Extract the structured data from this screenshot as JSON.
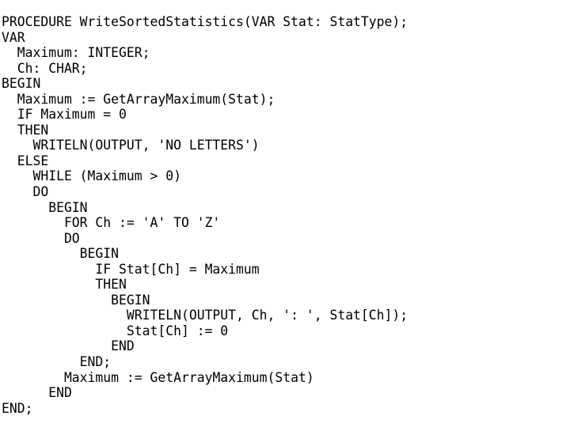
{
  "document": {
    "kind": "source-code-listing",
    "language": "Pascal",
    "procedure_name": "WriteSortedStatistics",
    "background_color": "#ffffff",
    "text_color": "#000000",
    "lines": [
      "PROCEDURE WriteSortedStatistics(VAR Stat: StatType);",
      "VAR",
      "  Maximum: INTEGER;",
      "  Ch: CHAR;",
      "BEGIN",
      "  Maximum := GetArrayMaximum(Stat);",
      "  IF Maximum = 0",
      "  THEN",
      "    WRITELN(OUTPUT, 'NO LETTERS')",
      "  ELSE",
      "    WHILE (Maximum > 0)",
      "    DO",
      "      BEGIN",
      "        FOR Ch := 'A' TO 'Z'",
      "        DO",
      "          BEGIN",
      "            IF Stat[Ch] = Maximum",
      "            THEN",
      "              BEGIN",
      "                WRITELN(OUTPUT, Ch, ': ', Stat[Ch]);",
      "                Stat[Ch] := 0",
      "              END",
      "          END;",
      "        Maximum := GetArrayMaximum(Stat)",
      "      END",
      "END;"
    ]
  }
}
